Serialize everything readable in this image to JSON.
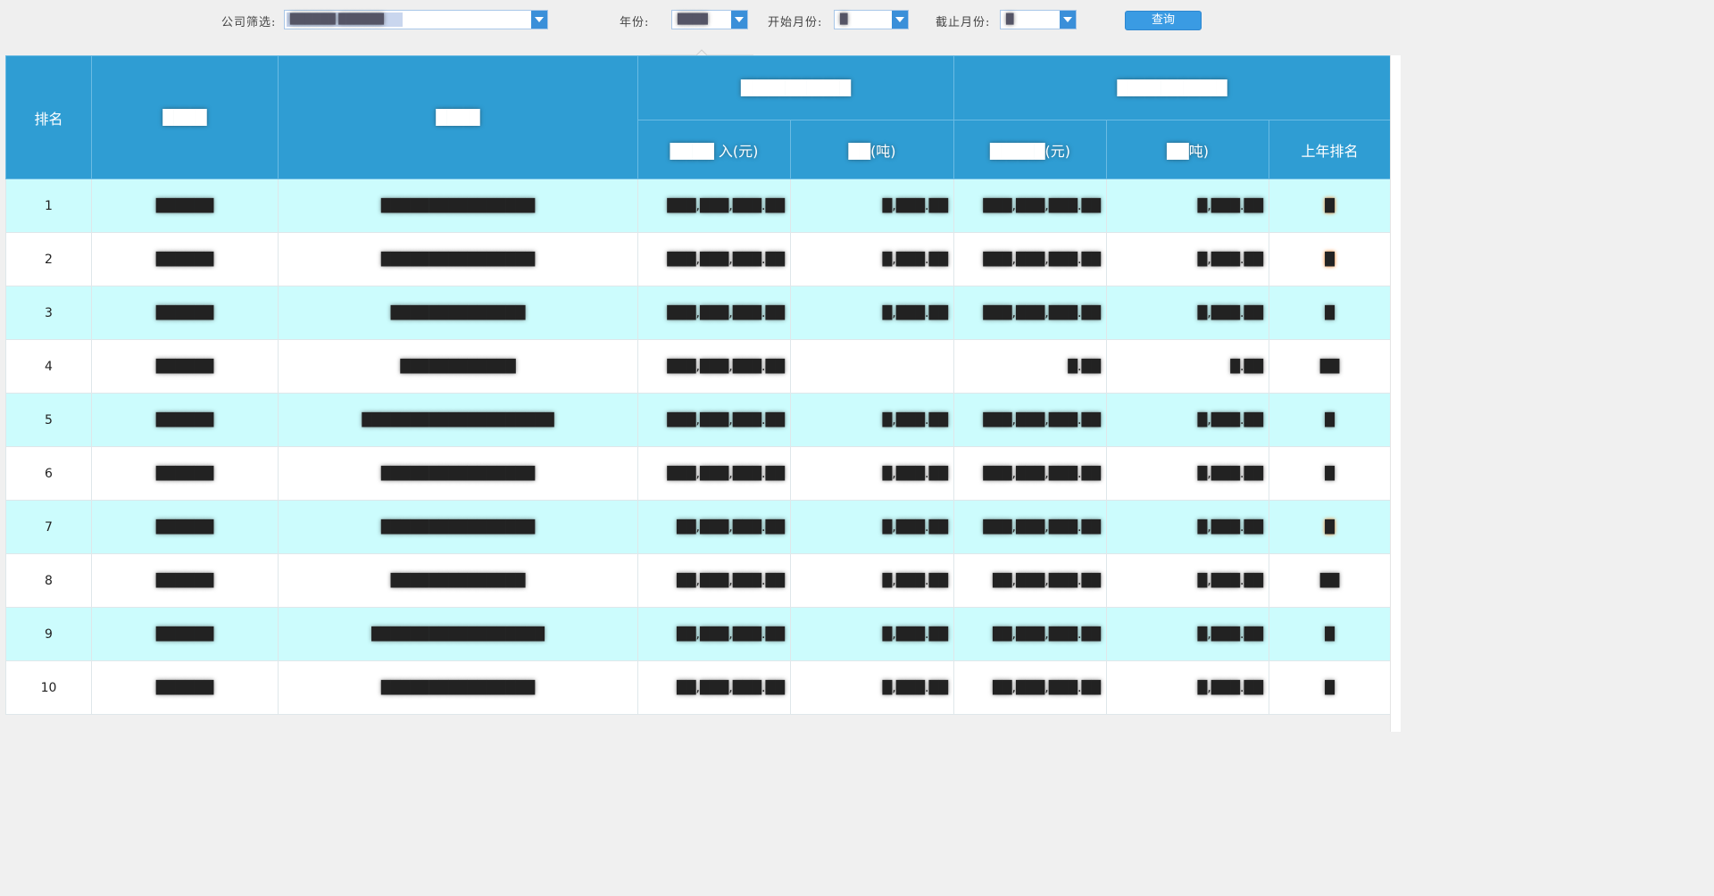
{
  "filters": {
    "company_label": "公司筛选:",
    "company_value": "██████ ██████",
    "year_label": "年份:",
    "year_value": "████",
    "start_month_label": "开始月份:",
    "start_month_value": "█",
    "end_month_label": "截止月份:",
    "end_month_value": "█",
    "query_button": "查询"
  },
  "table": {
    "headers": {
      "rank": "排名",
      "col2": "████",
      "col3": "████",
      "group1": "██████████",
      "group2": "██████████",
      "g1_income": "████ 入(元)",
      "g1_qty": "██(吨)",
      "g2_income": "█████(元)",
      "g2_qty": "██吨)",
      "last_year_rank": "上年排名"
    },
    "rows": [
      {
        "rank": "1",
        "region": "██████",
        "company": "████████████████",
        "inc1": "███,███,███.██",
        "qty1": "█,███.██",
        "inc2": "███,███,███.██",
        "qty2": "█,███.██",
        "prev": "█"
      },
      {
        "rank": "2",
        "region": "██████",
        "company": "████████████████",
        "inc1": "███,███,███.██",
        "qty1": "█,███.██",
        "inc2": "███,███,███.██",
        "qty2": "█,███.██",
        "prev": "█"
      },
      {
        "rank": "3",
        "region": "██████",
        "company": "██████████████",
        "inc1": "███,███,███.██",
        "qty1": "█,███.██",
        "inc2": "███,███,███.██",
        "qty2": "█,███.██",
        "prev": "█"
      },
      {
        "rank": "4",
        "region": "██████",
        "company": "████████████",
        "inc1": "███,███,███.██",
        "qty1": "",
        "inc2": "█.██",
        "qty2": "█.██",
        "prev": "██"
      },
      {
        "rank": "5",
        "region": "██████",
        "company": "████████████████████",
        "inc1": "███,███,███.██",
        "qty1": "█,███.██",
        "inc2": "███,███,███.██",
        "qty2": "█,███.██",
        "prev": "█"
      },
      {
        "rank": "6",
        "region": "██████",
        "company": "████████████████",
        "inc1": "███,███,███.██",
        "qty1": "█,███.██",
        "inc2": "███,███,███.██",
        "qty2": "█,███.██",
        "prev": "█"
      },
      {
        "rank": "7",
        "region": "██████",
        "company": "████████████████",
        "inc1": "██,███,███.██",
        "qty1": "█,███.██",
        "inc2": "███,███,███.██",
        "qty2": "█,███.██",
        "prev": "█"
      },
      {
        "rank": "8",
        "region": "██████",
        "company": "██████████████",
        "inc1": "██,███,███.██",
        "qty1": "█,███.██",
        "inc2": "██,███,███.██",
        "qty2": "█,███.██",
        "prev": "██"
      },
      {
        "rank": "9",
        "region": "██████",
        "company": "██████████████████",
        "inc1": "██,███,███.██",
        "qty1": "█,███.██",
        "inc2": "██,███,███.██",
        "qty2": "█,███.██",
        "prev": "█"
      },
      {
        "rank": "10",
        "region": "██████",
        "company": "████████████████",
        "inc1": "██,███,███.██",
        "qty1": "█,███.██",
        "inc2": "██,███,███.██",
        "qty2": "█,███.██",
        "prev": "█"
      }
    ]
  },
  "colors": {
    "header_bg": "#2f9dd3",
    "row_alt": "#ccfcfd",
    "highlight_rank": "#f07a18"
  }
}
